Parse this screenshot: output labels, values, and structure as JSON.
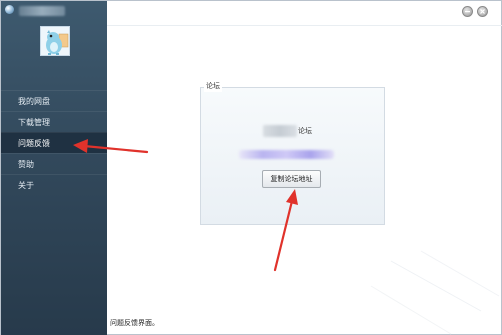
{
  "nav": {
    "items": [
      {
        "label": "我的网盘"
      },
      {
        "label": "下载管理"
      },
      {
        "label": "问题反馈"
      },
      {
        "label": "赞助"
      },
      {
        "label": "关于"
      }
    ],
    "active_index": 2
  },
  "forum": {
    "group_title": "论坛",
    "name_suffix": "论坛",
    "copy_button_label": "复制论坛地址"
  },
  "status": {
    "text": "问题反馈界面。"
  },
  "colors": {
    "sidebar": "#32495c",
    "sidebar_active": "#1f3142",
    "annotation_arrow": "#e0322b"
  },
  "icons": {
    "app": "app-icon",
    "minimize": "minimize-icon",
    "close": "close-icon",
    "avatar": "dinosaur-avatar"
  }
}
